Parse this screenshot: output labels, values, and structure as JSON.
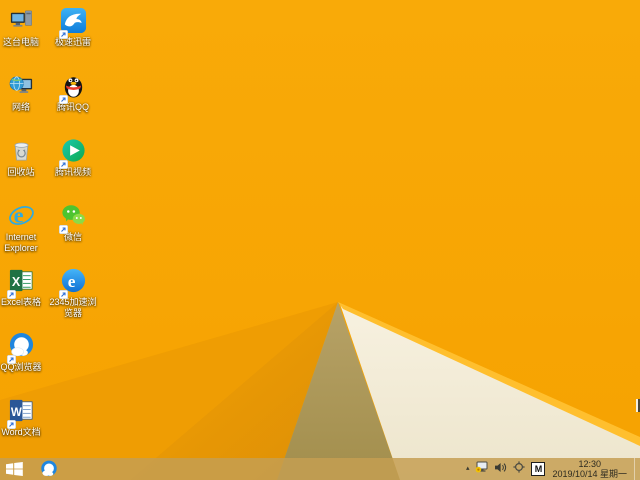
{
  "desktop": {
    "icons": [
      {
        "id": "this-pc",
        "label": "这台电脑",
        "shortcut": false
      },
      {
        "id": "xunlei",
        "label": "极速迅雷",
        "shortcut": true
      },
      {
        "id": "network",
        "label": "网络",
        "shortcut": false
      },
      {
        "id": "tencent-qq",
        "label": "腾讯QQ",
        "shortcut": true
      },
      {
        "id": "recycle-bin",
        "label": "回收站",
        "shortcut": false
      },
      {
        "id": "tencent-video",
        "label": "腾讯视频",
        "shortcut": true
      },
      {
        "id": "internet-explorer",
        "label": "Internet Explorer",
        "shortcut": false
      },
      {
        "id": "wechat",
        "label": "微信",
        "shortcut": true
      },
      {
        "id": "excel",
        "label": "Excel表格",
        "shortcut": true
      },
      {
        "id": "2345-browser",
        "label": "2345加速浏览器",
        "shortcut": true
      },
      {
        "id": "qq-browser",
        "label": "QQ浏览器",
        "shortcut": true
      },
      {
        "id": "word",
        "label": "Word文档",
        "shortcut": true
      }
    ]
  },
  "taskbar": {
    "pinned": [
      {
        "id": "qq-browser",
        "tooltip": "QQ浏览器"
      }
    ],
    "tray": {
      "input_method": "M",
      "clock_time": "12:30",
      "clock_date": "2019/10/14 星期一"
    }
  },
  "colors": {
    "wallpaper_main": "#F8A805",
    "wallpaper_shadow_wedge": "#EF9D03",
    "wallpaper_dark_fold": "#AE9A58",
    "wallpaper_cream_fold": "#F5EFDD",
    "wallpaper_edge_highlight": "#FFBF2E",
    "taskbar": "#C59F52"
  }
}
